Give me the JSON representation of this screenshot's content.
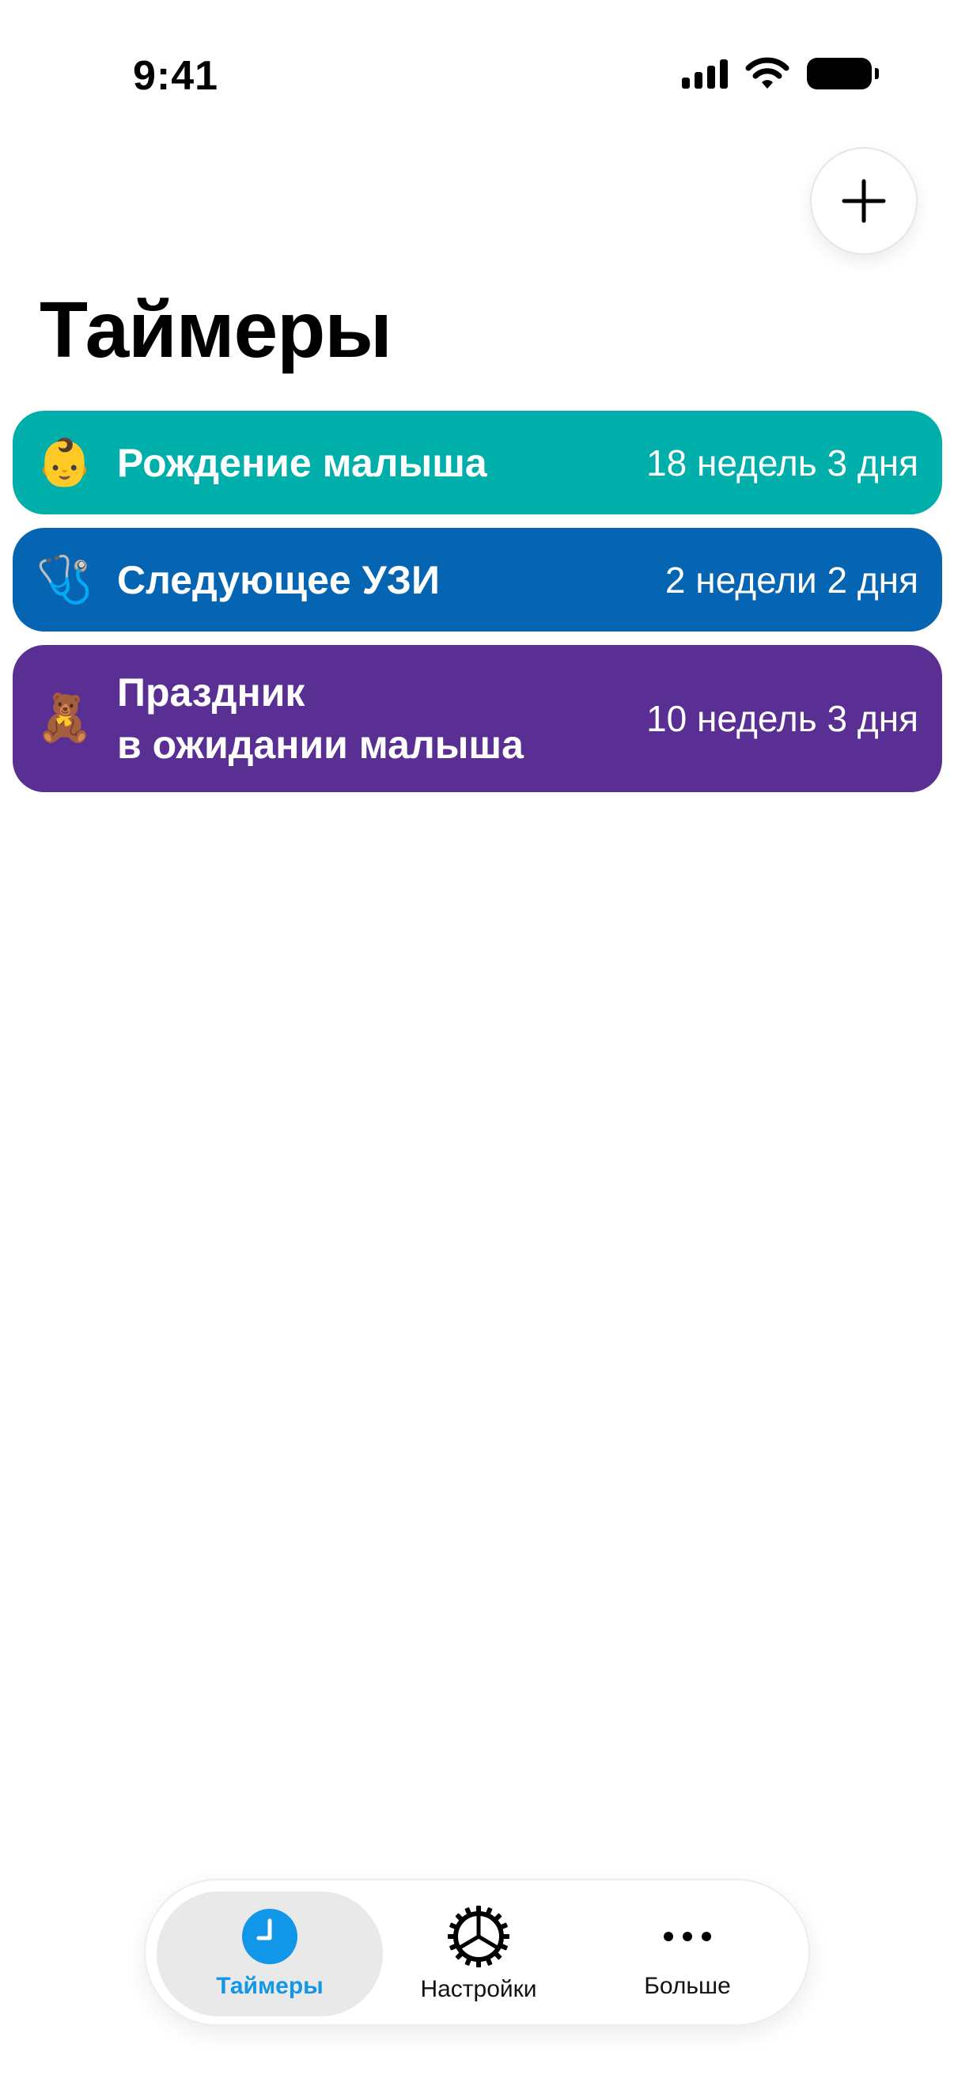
{
  "status_bar": {
    "time": "9:41"
  },
  "header": {
    "title": "Таймеры"
  },
  "timers": [
    {
      "emoji": "👶",
      "name": "Рождение малыша",
      "remaining": "18 недель 3 дня",
      "color": "#00AEAA"
    },
    {
      "emoji": "🩺",
      "name": "Следующее УЗИ",
      "remaining": "2 недели 2 дня",
      "color": "#0565B3"
    },
    {
      "emoji": "🧸",
      "name_line1": "Праздник",
      "name_line2": "в ожидании малыша",
      "remaining": "10 недель 3 дня",
      "color": "#5A2F93"
    }
  ],
  "tab_bar": {
    "items": [
      {
        "label": "Таймеры",
        "icon": "clock-icon",
        "active": true
      },
      {
        "label": "Настройки",
        "icon": "gear-icon",
        "active": false
      },
      {
        "label": "Больше",
        "icon": "more-icon",
        "active": false
      }
    ],
    "accent": "#1196E8"
  },
  "icons": {
    "add": "plus-icon"
  }
}
